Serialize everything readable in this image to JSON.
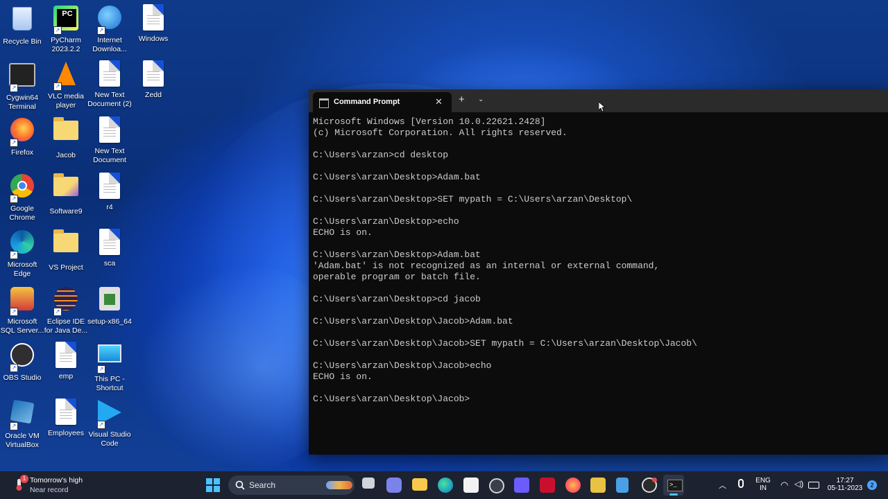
{
  "desktop": {
    "icons": [
      {
        "label": "Recycle Bin"
      },
      {
        "label": "PyCharm 2023.2.2"
      },
      {
        "label": "Internet Downloa..."
      },
      {
        "label": "Windows"
      },
      {
        "label": "Cygwin64 Terminal"
      },
      {
        "label": "VLC media player"
      },
      {
        "label": "New Text Document (2)"
      },
      {
        "label": "Zedd"
      },
      {
        "label": "Firefox"
      },
      {
        "label": "Jacob"
      },
      {
        "label": "New Text Document"
      },
      {
        "label": "Google Chrome"
      },
      {
        "label": "Software9"
      },
      {
        "label": "r4"
      },
      {
        "label": "Microsoft Edge"
      },
      {
        "label": "VS Project"
      },
      {
        "label": "sca"
      },
      {
        "label": "Microsoft SQL Server..."
      },
      {
        "label": "Eclipse IDE for Java De..."
      },
      {
        "label": "setup-x86_64"
      },
      {
        "label": "OBS Studio"
      },
      {
        "label": "emp"
      },
      {
        "label": "This PC - Shortcut"
      },
      {
        "label": "Oracle VM VirtualBox"
      },
      {
        "label": "Employees"
      },
      {
        "label": "Visual Studio Code"
      }
    ]
  },
  "terminal": {
    "tab_title": "Command Prompt",
    "close_glyph": "✕",
    "new_tab_glyph": "+",
    "dropdown_glyph": "⌄",
    "lines": [
      "Microsoft Windows [Version 10.0.22621.2428]",
      "(c) Microsoft Corporation. All rights reserved.",
      "",
      "C:\\Users\\arzan>cd desktop",
      "",
      "C:\\Users\\arzan\\Desktop>Adam.bat",
      "",
      "C:\\Users\\arzan\\Desktop>SET mypath = C:\\Users\\arzan\\Desktop\\",
      "",
      "C:\\Users\\arzan\\Desktop>echo",
      "ECHO is on.",
      "",
      "C:\\Users\\arzan\\Desktop>Adam.bat",
      "'Adam.bat' is not recognized as an internal or external command,",
      "operable program or batch file.",
      "",
      "C:\\Users\\arzan\\Desktop>cd jacob",
      "",
      "C:\\Users\\arzan\\Desktop\\Jacob>Adam.bat",
      "",
      "C:\\Users\\arzan\\Desktop\\Jacob>SET mypath = C:\\Users\\arzan\\Desktop\\Jacob\\",
      "",
      "C:\\Users\\arzan\\Desktop\\Jacob>echo",
      "ECHO is on.",
      "",
      "C:\\Users\\arzan\\Desktop\\Jacob>"
    ]
  },
  "taskbar": {
    "weather_title": "Tomorrow's high",
    "weather_subtitle": "Near record",
    "weather_badge": "1",
    "search_placeholder": "Search",
    "language_line1": "ENG",
    "language_line2": "IN",
    "time": "17:27",
    "date": "05-11-2023",
    "notification_count": "2"
  },
  "colors": {
    "taskbar_bg": "#1c2230",
    "terminal_bg": "#0c0c0c",
    "terminal_text": "#cccccc",
    "accent": "#0078d4"
  }
}
